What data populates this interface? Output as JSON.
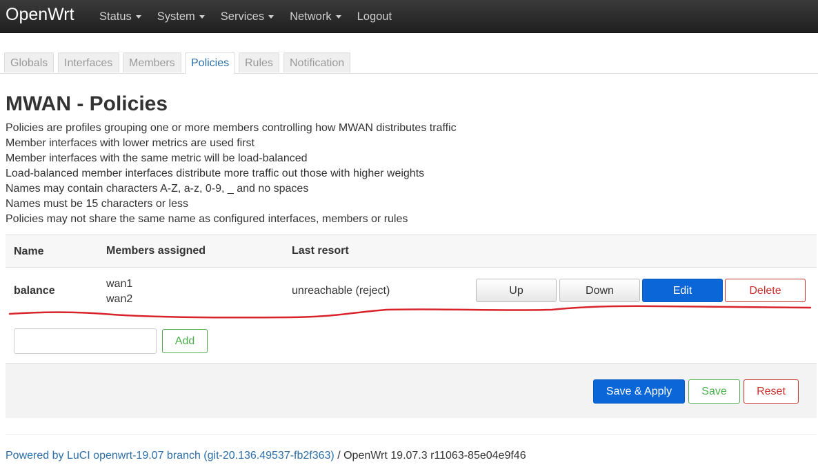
{
  "navbar": {
    "brand": "OpenWrt",
    "menu": [
      {
        "label": "Status",
        "has_caret": true
      },
      {
        "label": "System",
        "has_caret": true
      },
      {
        "label": "Services",
        "has_caret": true
      },
      {
        "label": "Network",
        "has_caret": true
      },
      {
        "label": "Logout",
        "has_caret": false
      }
    ]
  },
  "tabs": [
    {
      "label": "Globals",
      "active": false
    },
    {
      "label": "Interfaces",
      "active": false
    },
    {
      "label": "Members",
      "active": false
    },
    {
      "label": "Policies",
      "active": true
    },
    {
      "label": "Rules",
      "active": false
    },
    {
      "label": "Notification",
      "active": false
    }
  ],
  "page": {
    "title": "MWAN - Policies",
    "description": [
      "Policies are profiles grouping one or more members controlling how MWAN distributes traffic",
      "Member interfaces with lower metrics are used first",
      "Member interfaces with the same metric will be load-balanced",
      "Load-balanced member interfaces distribute more traffic out those with higher weights",
      "Names may contain characters A-Z, a-z, 0-9, _ and no spaces",
      "Names must be 15 characters or less",
      "Policies may not share the same name as configured interfaces, members or rules"
    ]
  },
  "table": {
    "headers": {
      "name": "Name",
      "members": "Members assigned",
      "last_resort": "Last resort"
    },
    "rows": [
      {
        "name": "balance",
        "members": [
          "wan1",
          "wan2"
        ],
        "last_resort": "unreachable (reject)",
        "buttons": {
          "up": "Up",
          "down": "Down",
          "edit": "Edit",
          "delete": "Delete"
        }
      }
    ]
  },
  "add": {
    "input_value": "",
    "button": "Add"
  },
  "actions": {
    "save_apply": "Save & Apply",
    "save": "Save",
    "reset": "Reset"
  },
  "footer": {
    "link_text": "Powered by LuCI openwrt-19.07 branch (git-20.136.49537-fb2f363)",
    "separator": " / ",
    "version": "OpenWrt 19.07.3 r11063-85e04e9f46"
  },
  "colors": {
    "navbar": "#1f1f1f",
    "primary": "#0b66d8",
    "danger": "#c9302c",
    "success": "#4cae4c",
    "annotation_line": "#d9232a"
  }
}
